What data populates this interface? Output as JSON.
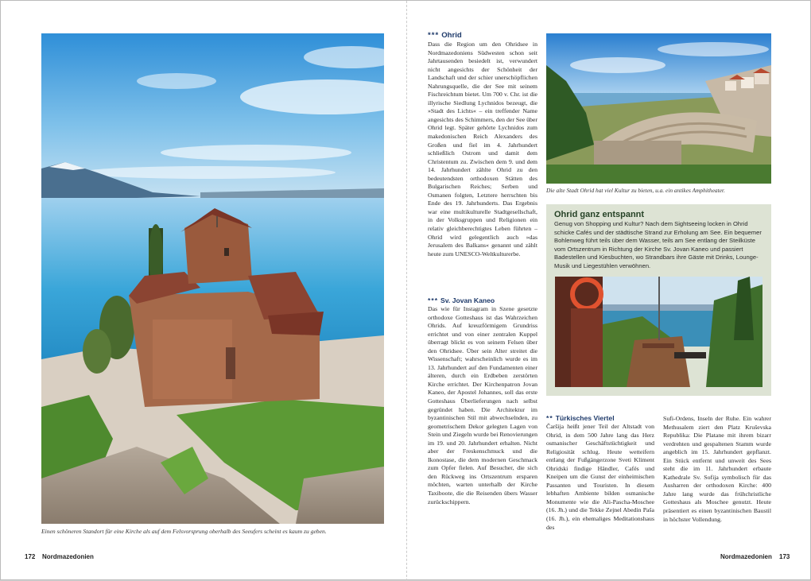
{
  "left_page": {
    "caption": "Einen schöneren Standort für eine Kirche als auf dem Felsvorsprung oberhalb des Seeufers scheint es kaum zu geben.",
    "page_number": "172",
    "running_head": "Nordmazedonien"
  },
  "right_page": {
    "page_number": "173",
    "running_head": "Nordmazedonien",
    "top_image_caption": "Die alte Stadt Ohrid hat viel Kultur zu bieten, u.a. ein antikes Amphitheater.",
    "sections": {
      "ohrid": {
        "stars": "***",
        "title": "Ohrid",
        "text": "Dass die Region um den Ohridsee in Nordmazedoniens Südwesten schon seit Jahrtausenden besiedelt ist, verwundert nicht angesichts der Schönheit der Landschaft und der schier unerschöpflichen Nahrungsquelle, die der See mit seinem Fischreichtum bietet. Um 700 v. Chr. ist die illyrische Siedlung Lychnidos bezeugt, die »Stadt des Lichts« – ein treffender Name angesichts des Schimmers, den der See über Ohrid legt. Später gehörte Lychnidos zum makedonischen Reich Alexanders des Großen und fiel im 4. Jahrhundert schließlich Ostrom und damit dem Christentum zu. Zwischen dem 9. und dem 14. Jahrhundert zählte Ohrid zu den bedeutendsten orthodoxen Stätten des Bulgarischen Reiches; Serben und Osmanen folgten, Letztere herrschten bis Ende des 19. Jahrhunderts. Das Ergebnis war eine multikulturelle Stadtgesellschaft, in der Volksgruppen und Religionen ein relativ gleichberechtigtes Leben führten – Ohrid wird gelegentlich auch »das Jerusalem des Balkans« genannt und zählt heute zum UNESCO-Weltkulturerbe."
      },
      "jovan": {
        "stars": "***",
        "title": "Sv. Jovan Kaneo",
        "text": "Das wie für Instagram in Szene gesetzte orthodoxe Gotteshaus ist das Wahrzeichen Ohrids. Auf kreuzförmigem Grundriss errichtet und von einer zentralen Kuppel überragt blickt es von seinem Felsen über den Ohridsee. Über sein Alter streitet die Wissenschaft; wahrscheinlich wurde es im 13. Jahrhundert auf den Fundamenten einer älteren, durch ein Erdbeben zerstörten Kirche errichtet. Der Kirchenpatron Jovan Kaneo, der Apostel Johannes, soll das erste Gotteshaus Überlieferungen nach selbst gegründet haben. Die Architektur im byzantinischen Stil mit abwechselnden, zu geometrischem Dekor gelegten Lagen von Stein und Ziegeln wurde bei Renovierungen im 19. und 20. Jahrhundert erhalten. Nicht aber der Freskenschmuck und die Ikonostase, die dem modernen Geschmack zum Opfer fielen. Auf Besucher, die sich den Rückweg ins Ortszentrum ersparen möchten, warten unterhalb der Kirche Taxiboote, die die Reisenden übers Wasser zurückschippern."
      },
      "viertel": {
        "stars": "**",
        "title": "Türkisches Viertel",
        "text_a": "Čaršija heißt jener Teil der Altstadt von Ohrid, in dem 500 Jahre lang das Herz osmanischer Geschäftstüchtigkeit und Religiosität schlug. Heute wetteifern entlang der Fußgängerzone Sveti Kliment Ohridski findige Händler, Cafés und Kneipen um die Gunst der einheimischen Passanten und Touristen. In diesem lebhaften Ambiente bilden osmanische Monumente wie die Ali-Pascha-Moschee (16. Jh.) und die Tekke Zejnel Abedin Paša (16. Jh.), ein ehemaliges Meditationshaus des",
        "text_b": "Sufi-Ordens, Inseln der Ruhe. Ein wahrer Methusalem ziert den Platz Kruševska Republika: Die Platane mit ihrem bizarr verdrehten und gespaltenen Stamm wurde angeblich im 15. Jahrhundert gepflanzt. Ein Stück entfernt und unweit des Sees steht die im 11. Jahrhundert erbaute Kathedrale Sv. Sofija symbolisch für das Ausharren der orthodoxen Kirche: 400 Jahre lang wurde das frühchristliche Gotteshaus als Moschee genutzt. Heute präsentiert es einen byzantinischen Baustil in höchster Vollendung."
      }
    },
    "infobox": {
      "title": "Ohrid ganz entspannt",
      "text": "Genug von Shopping und Kultur? Nach dem Sightseeing locken in Ohrid schicke Cafés und der städtische Strand zur Erholung am See. Ein bequemer Bohlenweg führt teils über dem Wasser, teils am See entlang der Steilküste vom Ortszentrum in Richtung der Kirche Sv. Jovan Kaneo und passiert Badestellen und Kiesbuchten, wo Strandbars ihre Gäste mit Drinks, Lounge-Musik und Liegestühlen verwöhnen."
    }
  },
  "colors": {
    "heading_blue": "#1e3a6a",
    "box_green": "#dde3d4",
    "box_title": "#264226"
  }
}
